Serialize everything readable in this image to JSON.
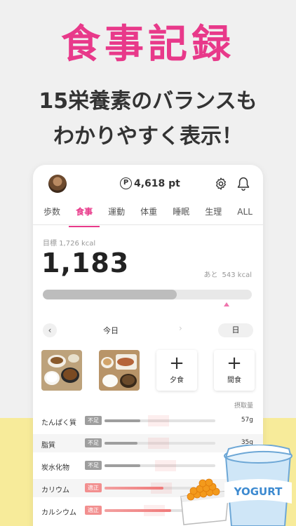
{
  "hero": {
    "title": "食事記録",
    "line1": "15栄養素のバランスも",
    "line2": "わかりやすく表示！"
  },
  "header": {
    "points_symbol": "P",
    "points": "4,618 pt",
    "icons": [
      "avatar",
      "gear-icon",
      "bell-icon"
    ]
  },
  "tabs": [
    {
      "label": "歩数",
      "active": false
    },
    {
      "label": "食事",
      "active": true
    },
    {
      "label": "運動",
      "active": false
    },
    {
      "label": "体重",
      "active": false
    },
    {
      "label": "睡眠",
      "active": false
    },
    {
      "label": "生理",
      "active": false
    },
    {
      "label": "ALL",
      "active": false
    }
  ],
  "calories": {
    "goal_label": "目標 1,726 kcal",
    "current": "1,183",
    "remaining_prefix": "あと",
    "remaining": "543 kcal",
    "progress_fraction": 0.64
  },
  "day_nav": {
    "prev": "‹",
    "label": "今日",
    "next": "›",
    "view": "日"
  },
  "meals": [
    {
      "type": "photo"
    },
    {
      "type": "photo"
    },
    {
      "type": "add",
      "label": "夕食"
    },
    {
      "type": "add",
      "label": "間食"
    }
  ],
  "nutrients": {
    "header": "摂取量",
    "rows": [
      {
        "name": "たんぱく質",
        "status": "不足",
        "value": "57g",
        "fill": 0.32
      },
      {
        "name": "脂質",
        "status": "不足",
        "value": "35g",
        "fill": 0.3
      },
      {
        "name": "炭水化物",
        "status": "不足",
        "value": "",
        "fill": 0.32
      },
      {
        "name": "カリウム",
        "status": "適正",
        "value": "",
        "fill": 0.53
      },
      {
        "name": "カルシウム",
        "status": "適正",
        "value": "",
        "fill": 0.6
      }
    ]
  },
  "yogurt_label": "YOGURT",
  "colors": {
    "accent": "#e8398a",
    "band": "#f7eb9a",
    "good": "#f28f8f",
    "low": "#9e9e9e"
  }
}
